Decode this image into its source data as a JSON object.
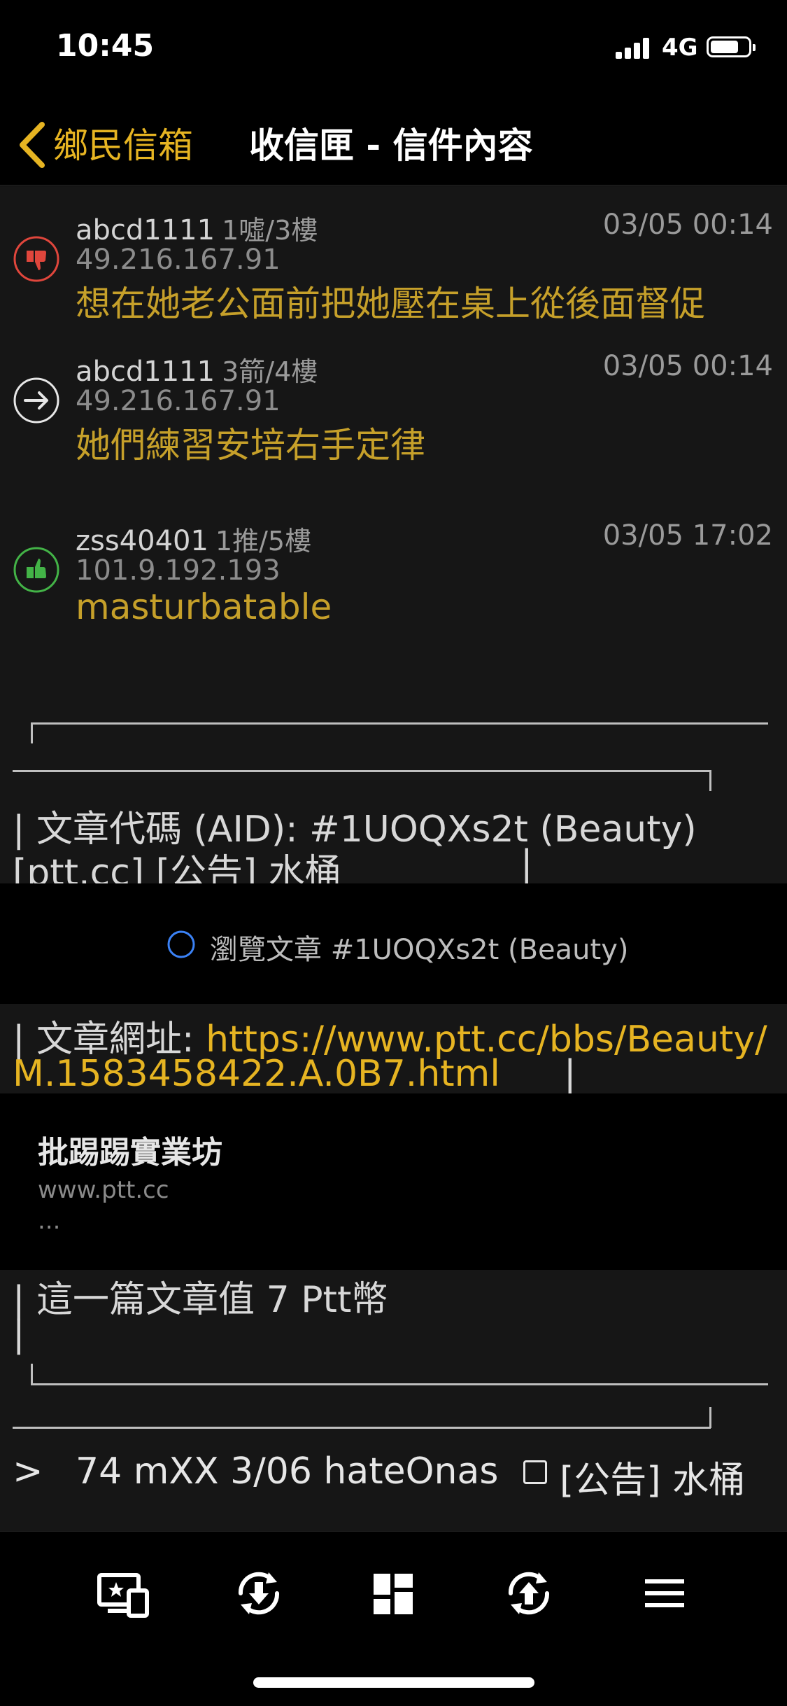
{
  "status_bar": {
    "time": "10:45",
    "network": "4G",
    "battery_level": 0.75
  },
  "nav": {
    "back_label": "鄉民信箱",
    "title": "收信匣 - 信件內容"
  },
  "comments": [
    {
      "type": "boo",
      "user": "abcd1111",
      "floor": "1噓/3樓",
      "time": "03/05 00:14",
      "ip": "49.216.167.91",
      "text": "想在她老公面前把她壓在桌上從後面督促"
    },
    {
      "type": "arrow",
      "user": "abcd1111",
      "floor": "3箭/4樓",
      "time": "03/05 00:14",
      "ip": "49.216.167.91",
      "text": "她們練習安培右手定律"
    },
    {
      "type": "push",
      "user": "zss40401",
      "floor": "1推/5樓",
      "time": "03/05 17:02",
      "ip": "101.9.192.193",
      "text": "masturbatable"
    }
  ],
  "aid_box": {
    "line1": "| 文章代碼 (AID): #1UOQXs2t (Beauty)",
    "line2": "[ptt.cc] [公告] 水桶",
    "line2_end": "|"
  },
  "aid_preview": {
    "label": "瀏覽文章 #1UOQXs2t (Beauty)"
  },
  "url_box": {
    "prefix": "| 文章網址: ",
    "url_part1": "https://www.ptt.cc/bbs/Beauty/",
    "url_part2": "M.1583458422.A.0B7.html",
    "suffix": "|"
  },
  "link_card": {
    "title": "批踢踢實業坊",
    "domain": "www.ptt.cc",
    "ellipsis": "..."
  },
  "coin_box": {
    "line1": "| 這一篇文章值 7 Ptt幣",
    "line2": "|"
  },
  "reply_line": {
    "prompt": ">",
    "text": "74 mXX 3/06 hateOnas",
    "subject": "[公告] 水桶"
  },
  "toolbar": {
    "icons": [
      "screen-icon",
      "reload-down-icon",
      "dashboard-icon",
      "reload-up-icon",
      "menu-icon"
    ]
  }
}
